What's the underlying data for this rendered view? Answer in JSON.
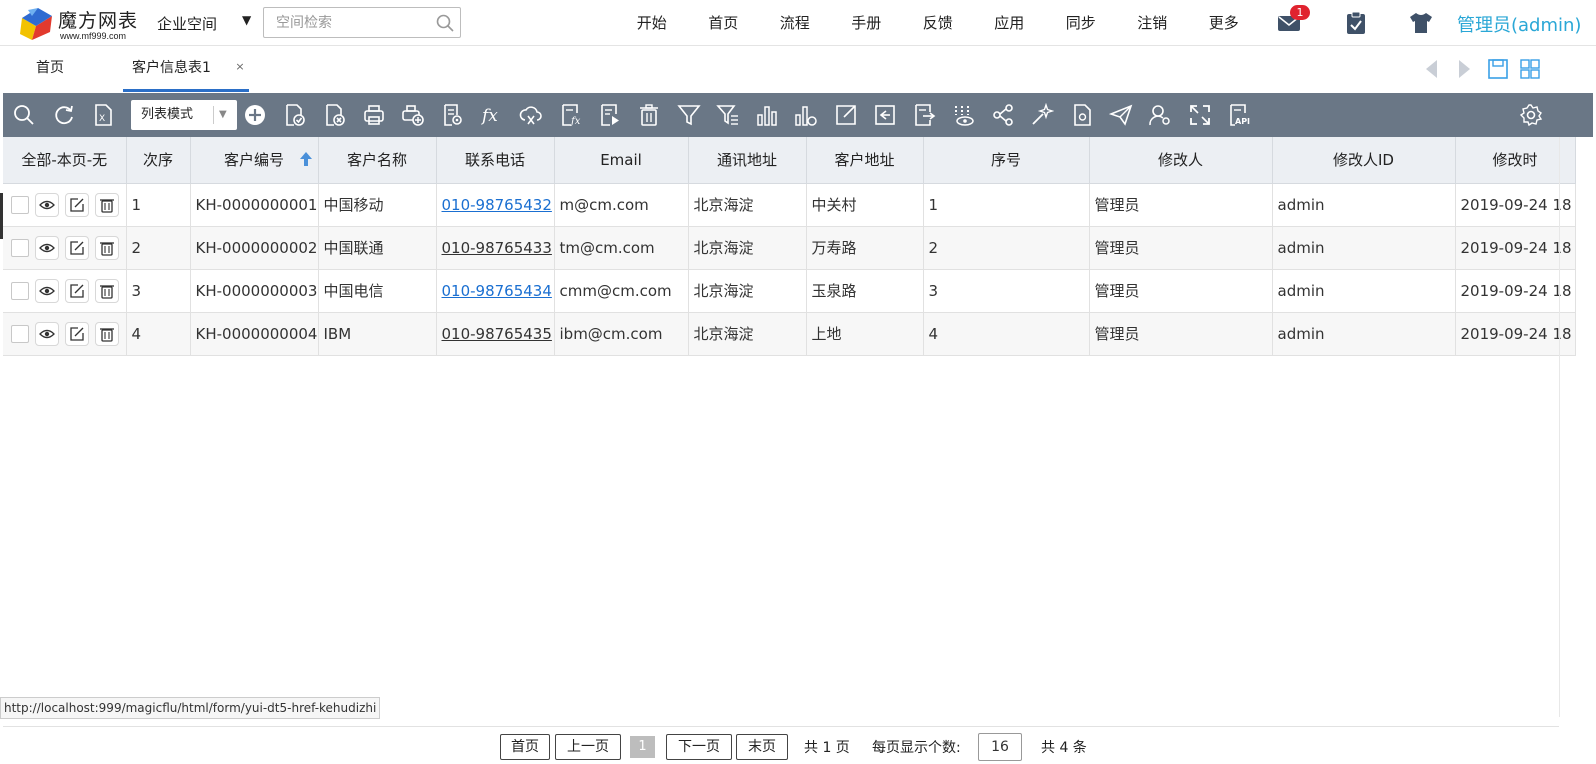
{
  "logo": {
    "title": "魔方网表",
    "url": "www.mf999.com"
  },
  "header": {
    "space_label": "企业空间",
    "space_caret": "▼",
    "search_placeholder": "空间检索",
    "nav": [
      "开始",
      "首页",
      "流程",
      "手册",
      "反馈",
      "应用",
      "同步",
      "注销",
      "更多"
    ],
    "mail_badge": "1",
    "user": "管理员(admin)"
  },
  "tabs": {
    "home": "首页",
    "active": "客户信息表1",
    "close": "×"
  },
  "toolbar": {
    "mode": "列表模式"
  },
  "table": {
    "columns": [
      "全部-本页-无",
      "次序",
      "客户编号",
      "客户名称",
      "联系电话",
      "Email",
      "通讯地址",
      "客户地址",
      "序号",
      "修改人",
      "修改人ID",
      "修改时"
    ],
    "rows": [
      {
        "order": "1",
        "code": "KH-0000000001",
        "name": "中国移动",
        "phone": "010-98765432",
        "email": "m@cm.com",
        "mail_addr": "北京海淀",
        "addr": "中关村",
        "seq": "1",
        "modifier": "管理员",
        "modifier_id": "admin",
        "time": "2019-09-24 18"
      },
      {
        "order": "2",
        "code": "KH-0000000002",
        "name": "中国联通",
        "phone": "010-98765433",
        "email": "tm@cm.com",
        "mail_addr": "北京海淀",
        "addr": "万寿路",
        "seq": "2",
        "modifier": "管理员",
        "modifier_id": "admin",
        "time": "2019-09-24 18"
      },
      {
        "order": "3",
        "code": "KH-0000000003",
        "name": "中国电信",
        "phone": "010-98765434",
        "email": "cmm@cm.com",
        "mail_addr": "北京海淀",
        "addr": "玉泉路",
        "seq": "3",
        "modifier": "管理员",
        "modifier_id": "admin",
        "time": "2019-09-24 18"
      },
      {
        "order": "4",
        "code": "KH-0000000004",
        "name": "IBM",
        "phone": "010-98765435",
        "email": "ibm@cm.com",
        "mail_addr": "北京海淀",
        "addr": "上地",
        "seq": "4",
        "modifier": "管理员",
        "modifier_id": "admin",
        "time": "2019-09-24 18"
      }
    ]
  },
  "status_url": "http://localhost:999/magicflu/html/form/yui-dt5-href-kehudizhi",
  "pager": {
    "first": "首页",
    "prev": "上一页",
    "current": "1",
    "next": "下一页",
    "last": "末页",
    "total_pages": "共 1 页",
    "page_size_label": "每页显示个数:",
    "page_size": "16",
    "total_items": "共 4 条"
  }
}
